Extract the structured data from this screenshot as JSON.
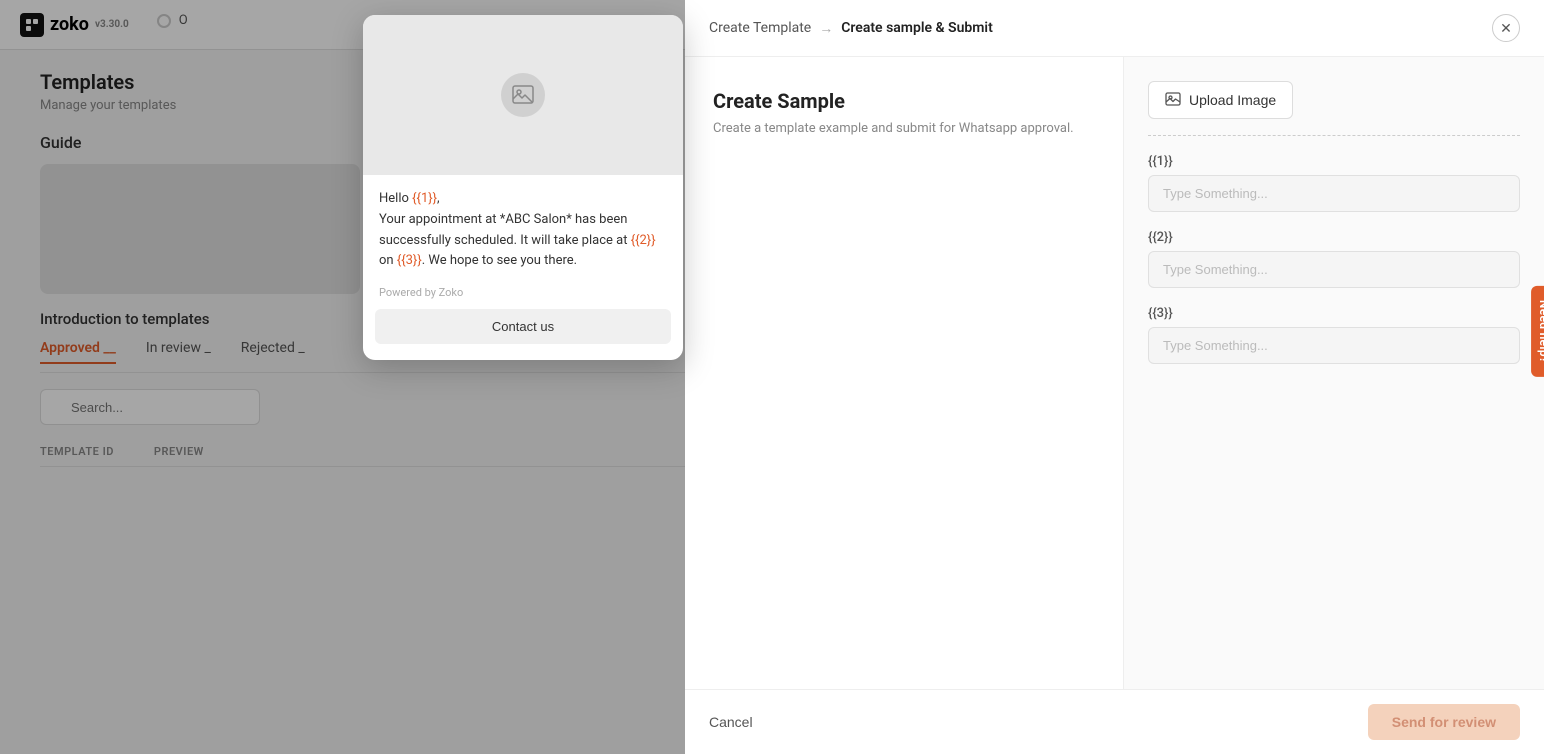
{
  "app": {
    "name": "zoko",
    "version": "v3.30.0"
  },
  "background": {
    "section_title": "Templates",
    "section_sub": "Manage your templates",
    "guide_label": "Guide",
    "tabs": [
      "Approved",
      "In review",
      "Rejected"
    ],
    "active_tab": "Approved",
    "search_placeholder": "Search...",
    "table_headers": [
      "TEMPLATE ID",
      "PREVIEW"
    ]
  },
  "preview_card": {
    "message_parts": [
      {
        "text": "Hello "
      },
      {
        "text": "{{1}}",
        "is_var": true
      },
      {
        "text": ","
      }
    ],
    "body": "Your appointment at *ABC Salon* has been successfully scheduled. It will take place at ",
    "var2": "{{2}}",
    "mid_text": " on ",
    "var3": "{{3}}",
    "end_text": ". We hope to see you there.",
    "powered_by": "Powered by Zoko",
    "contact_button": "Contact us"
  },
  "modal": {
    "breadcrumb_parent": "Create Template",
    "breadcrumb_current": "Create sample & Submit",
    "section_title": "Create Sample",
    "section_sub": "Create a template example and submit for Whatsapp approval.",
    "upload_image_label": "Upload Image",
    "fields": [
      {
        "label": "{{1}}",
        "placeholder": "Type Something..."
      },
      {
        "label": "{{2}}",
        "placeholder": "Type Something..."
      },
      {
        "label": "{{3}}",
        "placeholder": "Type Something..."
      }
    ],
    "cancel_label": "Cancel",
    "send_review_label": "Send for review",
    "need_help_label": "Need help?"
  }
}
